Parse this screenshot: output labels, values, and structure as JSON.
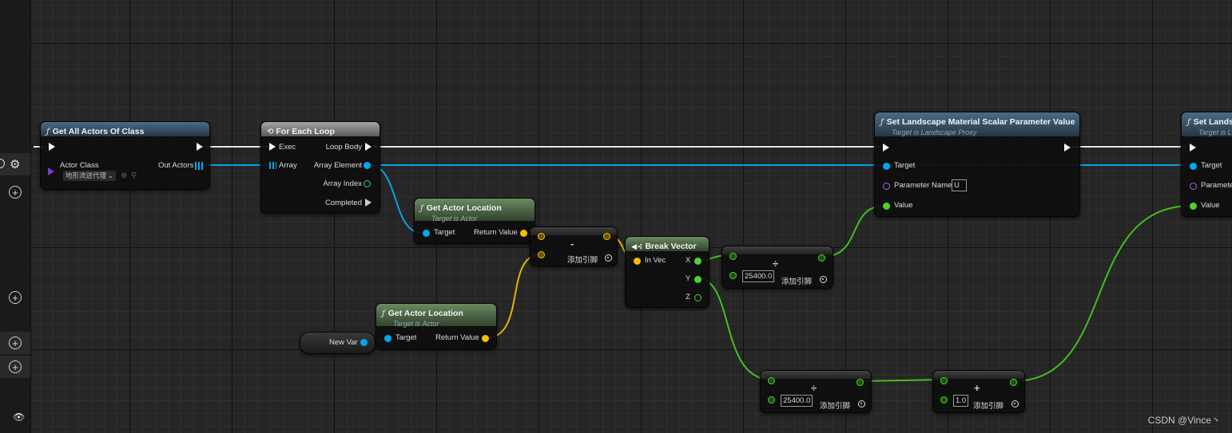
{
  "left_panel": {
    "settings_icon": "gear-icon",
    "add_icon": "plus-circle-icon",
    "eye_icon": "eye-icon"
  },
  "nodes": {
    "get_all_actors": {
      "title": "Get All Actors Of Class",
      "actor_class_label": "Actor Class",
      "actor_class_value": "地形流送代理",
      "out_actors_label": "Out Actors"
    },
    "for_each": {
      "title": "For Each Loop",
      "exec": "Exec",
      "array": "Array",
      "loop_body": "Loop Body",
      "array_element": "Array Element",
      "array_index": "Array Index",
      "completed": "Completed"
    },
    "get_actor_location_1": {
      "title": "Get Actor Location",
      "subtitle": "Target is Actor",
      "target": "Target",
      "return_value": "Return Value"
    },
    "get_actor_location_2": {
      "title": "Get Actor Location",
      "subtitle": "Target is Actor",
      "target": "Target",
      "return_value": "Return Value"
    },
    "new_var": {
      "label": "New Var"
    },
    "subtract": {
      "op": "-",
      "add_pin": "添加引脚"
    },
    "break_vector": {
      "title": "Break Vector",
      "in_vec": "In Vec",
      "x": "X",
      "y": "Y",
      "z": "Z"
    },
    "divide_1": {
      "op": "÷",
      "value": "25400.0",
      "add_pin": "添加引脚"
    },
    "divide_2": {
      "op": "÷",
      "value": "25400.0",
      "add_pin": "添加引脚"
    },
    "add": {
      "op": "+",
      "value": "1.0",
      "add_pin": "添加引脚"
    },
    "set_param_1": {
      "title": "Set Landscape Material Scalar Parameter Value",
      "subtitle": "Target is Landscape Proxy",
      "target": "Target",
      "param_name": "Parameter Name",
      "param_value": "U",
      "value": "Value"
    },
    "set_param_2": {
      "title": "Set Lands",
      "subtitle": "Target is L",
      "target": "Target",
      "param_name": "Paramete",
      "value": "Value"
    }
  },
  "colors": {
    "exec": "#f4f4f4",
    "object": "#00a8f0",
    "vector": "#f0c000",
    "float": "#50d030",
    "name": "#b060e0",
    "class": "#7a3ad0"
  },
  "watermark": "CSDN @Vince丶"
}
